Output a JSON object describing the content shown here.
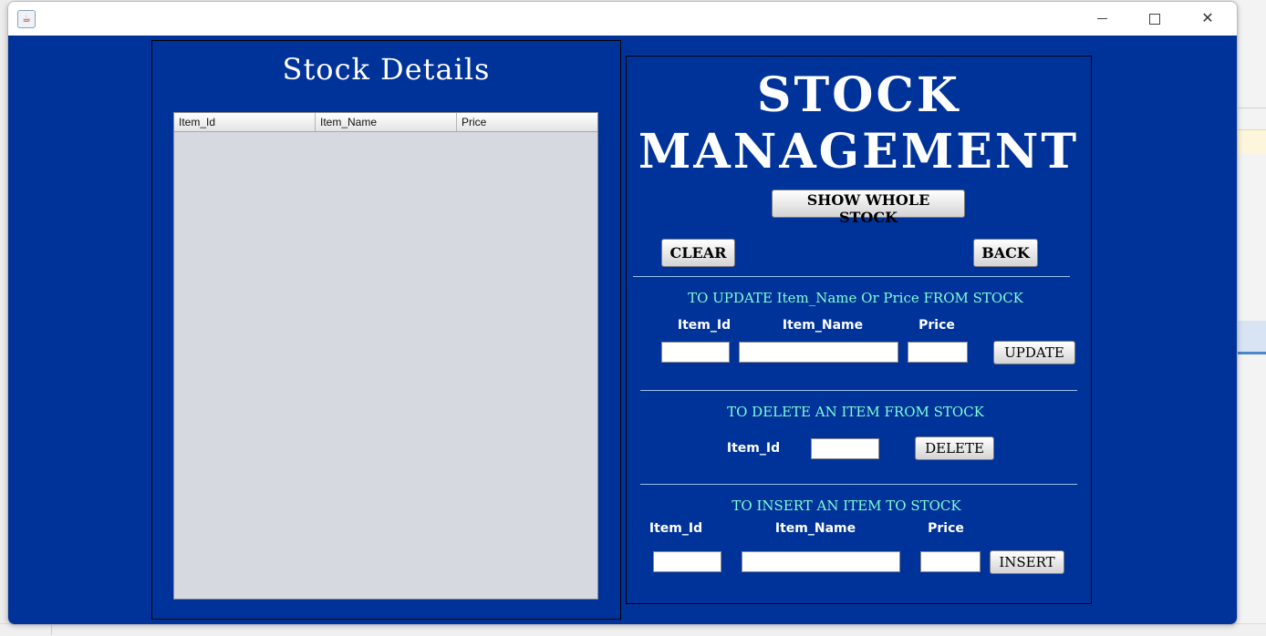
{
  "window": {
    "icon_glyph": "☕",
    "controls": {
      "minimize": "minimize-icon",
      "maximize": "maximize-icon",
      "close": "✕"
    }
  },
  "stock_details": {
    "title": "Stock Details",
    "columns": [
      "Item_Id",
      "Item_Name",
      "Price"
    ],
    "rows": []
  },
  "stock_management": {
    "title_line1": "STOCK",
    "title_line2": "MANAGEMENT",
    "show_whole_stock_label": "SHOW WHOLE STOCK",
    "clear_label": "CLEAR",
    "back_label": "BACK",
    "update_section": {
      "title": "TO UPDATE Item_Name Or Price FROM STOCK",
      "item_id_label": "Item_Id",
      "item_name_label": "Item_Name",
      "price_label": "Price",
      "item_id_value": "",
      "item_name_value": "",
      "price_value": "",
      "button_label": "UPDATE"
    },
    "delete_section": {
      "title": "TO DELETE AN ITEM FROM STOCK",
      "item_id_label": "Item_Id",
      "item_id_value": "",
      "button_label": "DELETE"
    },
    "insert_section": {
      "title": "TO INSERT AN ITEM TO STOCK",
      "item_id_label": "Item_Id",
      "item_name_label": "Item_Name",
      "price_label": "Price",
      "item_id_value": "",
      "item_name_value": "",
      "price_value": "",
      "button_label": "INSERT"
    }
  },
  "colors": {
    "background": "#003399",
    "section_title": "#7fffd4",
    "table_bg": "#d6d9e0"
  }
}
